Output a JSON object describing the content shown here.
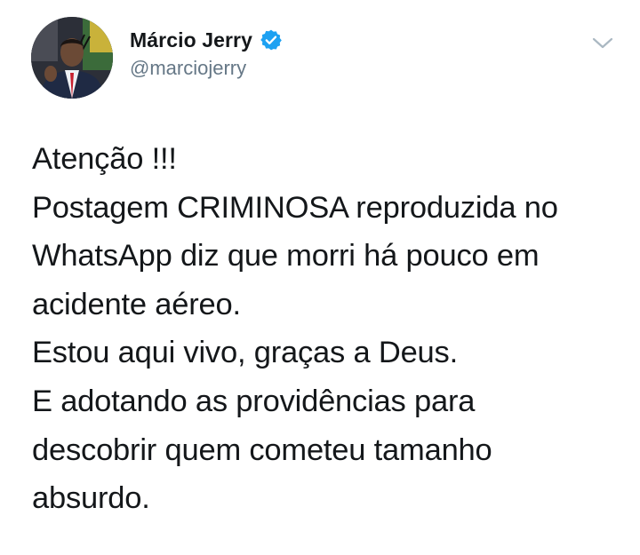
{
  "tweet": {
    "author": {
      "display_name": "Márcio Jerry",
      "handle": "@marciojerry",
      "verified": true,
      "avatar_icon": "profile-photo"
    },
    "menu_icon": "chevron-down-icon",
    "text_lines": [
      "Atenção !!!",
      "Postagem CRIMINOSA reproduzida no",
      "WhatsApp diz que morri há pouco em",
      "acidente aéreo.",
      "Estou aqui vivo, graças a Deus.",
      "E adotando as providências para",
      "descobrir quem cometeu tamanho",
      "absurdo."
    ]
  },
  "colors": {
    "text_primary": "#14171a",
    "text_secondary": "#657786",
    "verified_blue": "#1da1f2",
    "chevron": "#aab8c2"
  }
}
